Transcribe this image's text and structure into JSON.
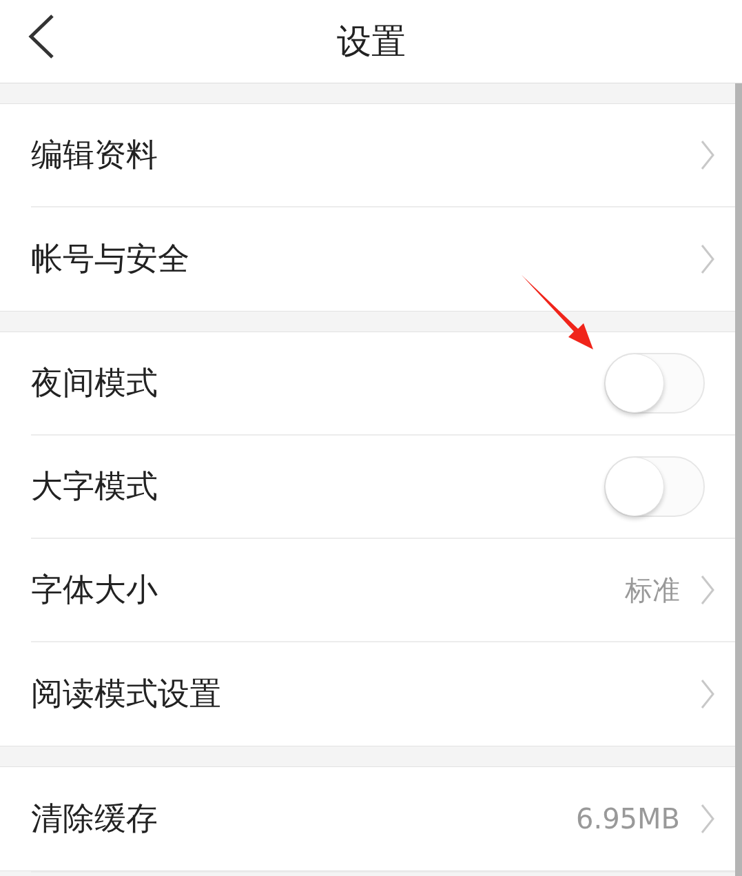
{
  "header": {
    "title": "设置"
  },
  "sections": [
    {
      "rows": [
        {
          "kind": "link",
          "label": "编辑资料"
        },
        {
          "kind": "link",
          "label": "帐号与安全"
        }
      ]
    },
    {
      "rows": [
        {
          "kind": "toggle",
          "label": "夜间模式",
          "on": false
        },
        {
          "kind": "toggle",
          "label": "大字模式",
          "on": false
        },
        {
          "kind": "link",
          "label": "字体大小",
          "value": "标准"
        },
        {
          "kind": "link",
          "label": "阅读模式设置"
        }
      ]
    },
    {
      "rows": [
        {
          "kind": "link",
          "label": "清除缓存",
          "value": "6.95MB"
        }
      ]
    }
  ]
}
